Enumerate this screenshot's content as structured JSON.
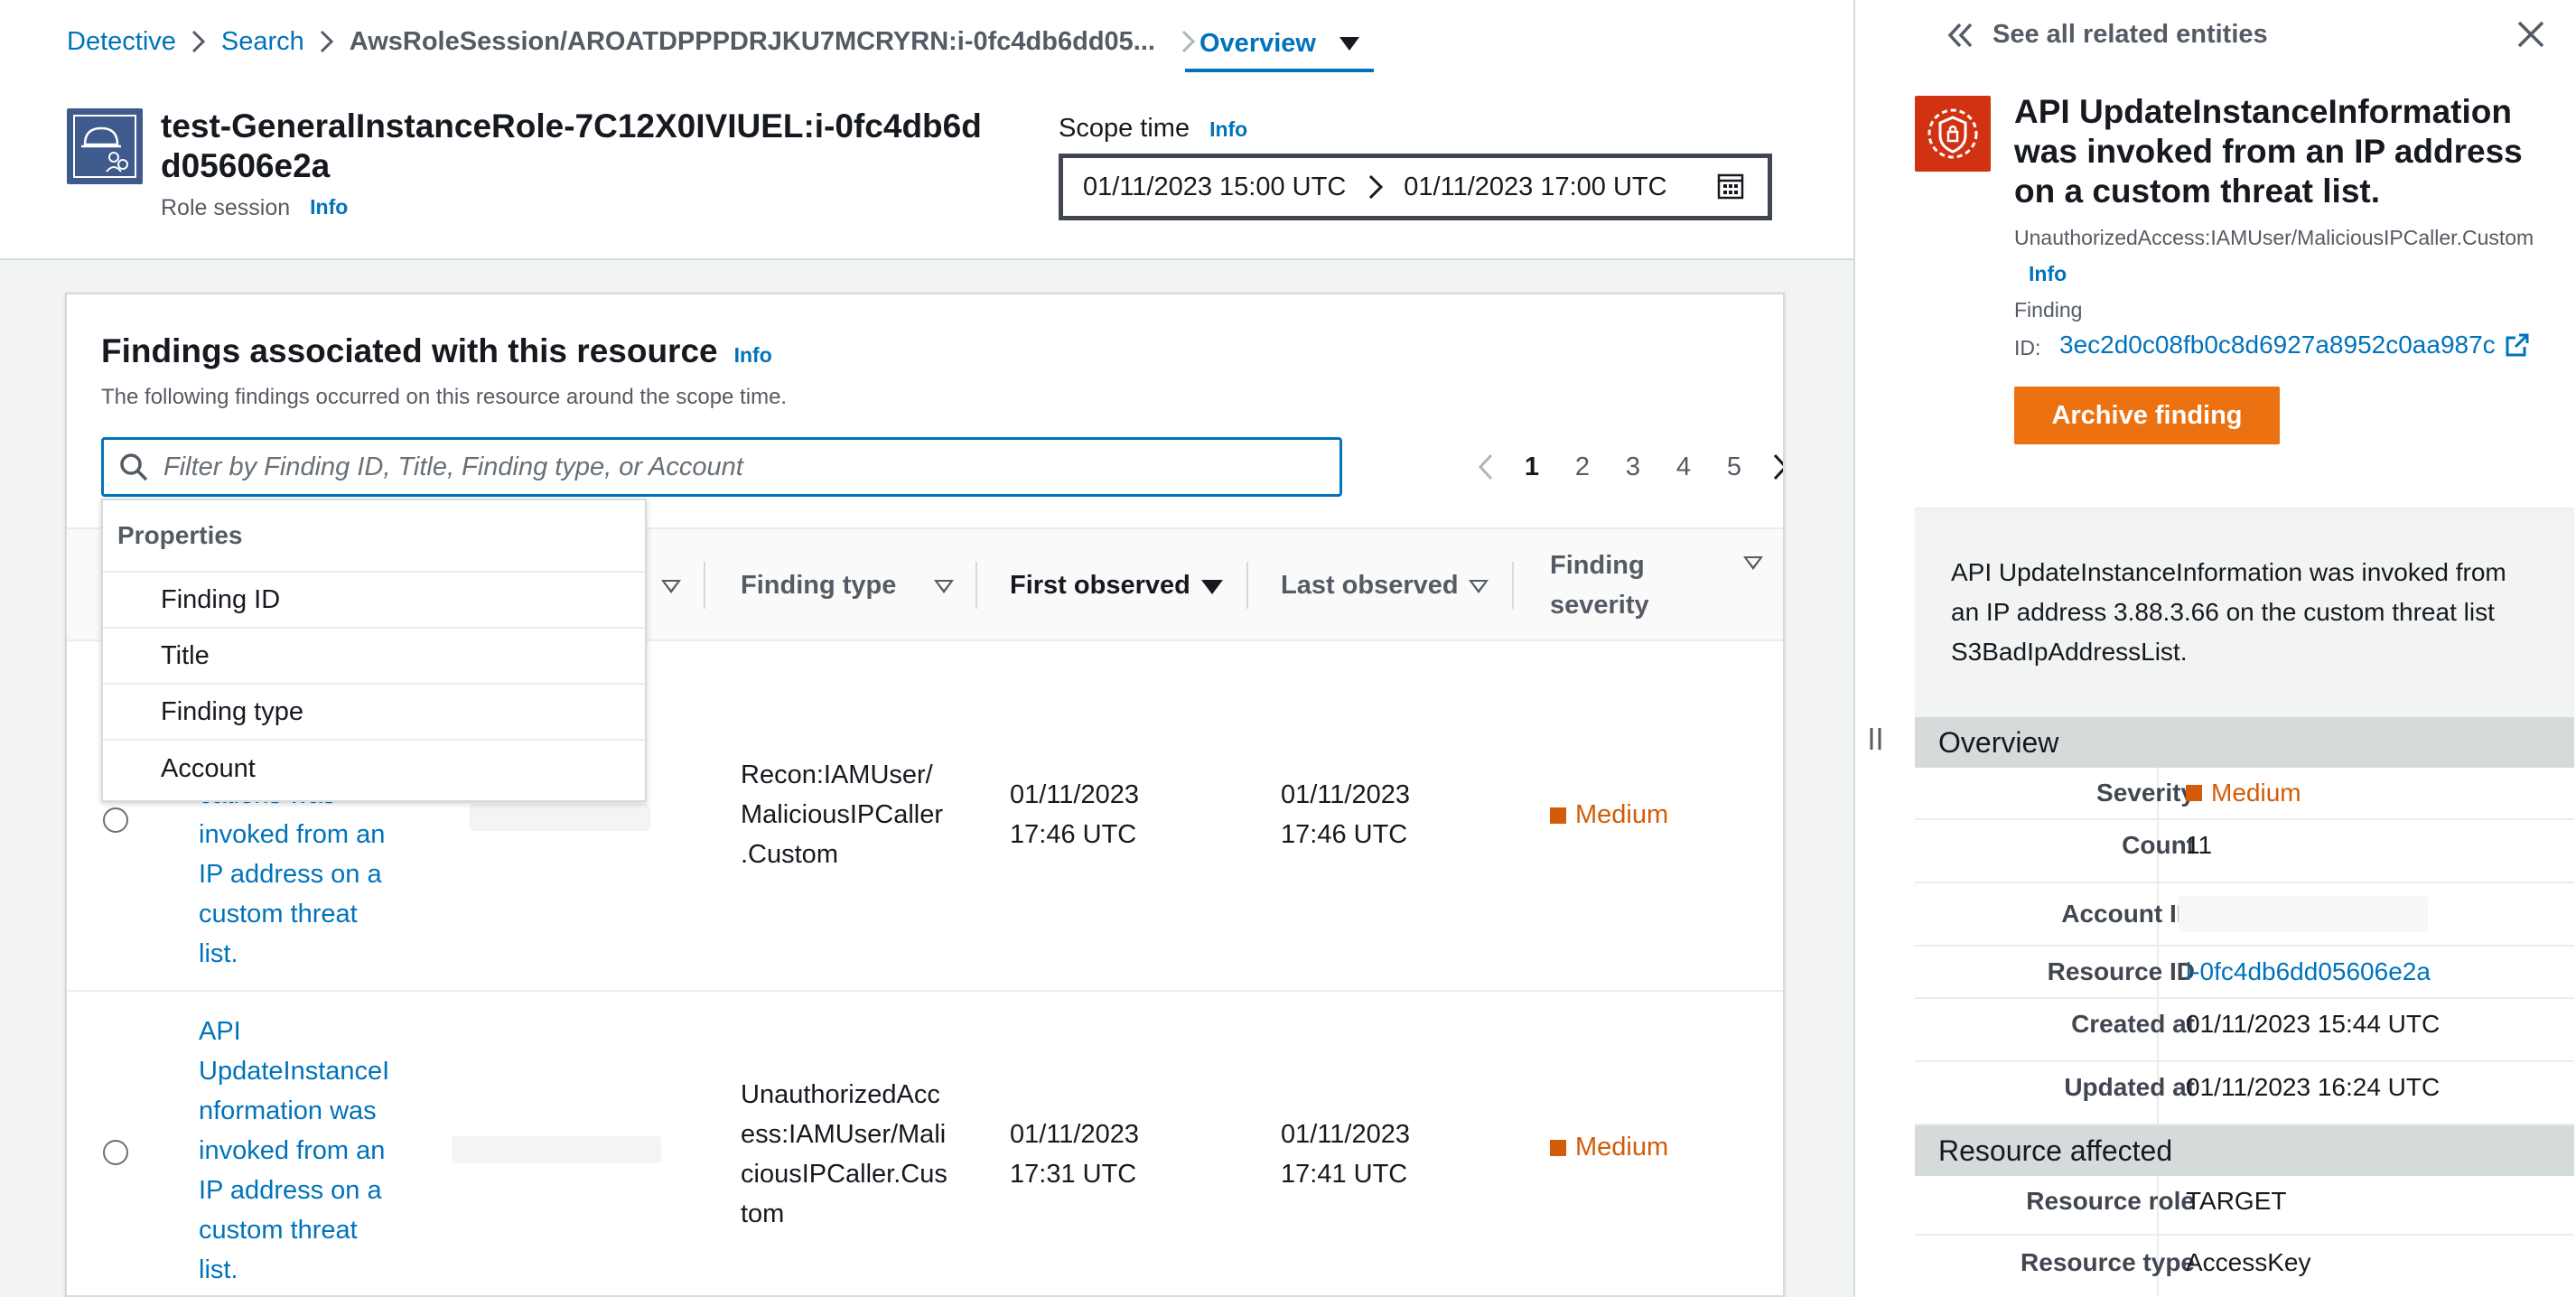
{
  "breadcrumb": {
    "items": [
      "Detective",
      "Search",
      "AwsRoleSession/AROATDPPPDRJKU7MCRYRN:i-0fc4db6dd05..."
    ],
    "current": "Overview"
  },
  "resource": {
    "title": "test-GeneralInstanceRole-7C12X0IVIUEL:i-0fc4db6dd05606e2a",
    "type": "Role session",
    "info": "Info"
  },
  "scope": {
    "label": "Scope time",
    "info": "Info",
    "start": "01/11/2023 15:00 UTC",
    "end": "01/11/2023 17:00 UTC"
  },
  "findings_card": {
    "title": "Findings associated with this resource",
    "info": "Info",
    "description": "The following findings occurred on this resource around the scope time.",
    "filter_placeholder": "Filter by Finding ID, Title, Finding type, or Account",
    "pages": [
      "1",
      "2",
      "3",
      "4",
      "5"
    ],
    "current_page": "1",
    "columns": {
      "finding_type": "Finding type",
      "first_observed": "First observed",
      "last_observed": "Last observed",
      "severity_line1": "Finding",
      "severity_line2": "severity"
    },
    "properties_menu": {
      "header": "Properties",
      "items": [
        "Finding ID",
        "Title",
        "Finding type",
        "Account"
      ]
    },
    "rows": [
      {
        "title_lines": [
          "cations was",
          "invoked from an",
          "IP address on a",
          "custom threat",
          "list."
        ],
        "type_lines": [
          "Recon:IAMUser/",
          "MaliciousIPCaller",
          ".Custom"
        ],
        "first_lines": [
          "01/11/2023",
          "17:46 UTC"
        ],
        "last_lines": [
          "01/11/2023",
          "17:46 UTC"
        ],
        "severity": "Medium"
      },
      {
        "title_lines": [
          "API",
          "UpdateInstanceI",
          "nformation was",
          "invoked from an",
          "IP address on a",
          "custom threat",
          "list."
        ],
        "type_lines": [
          "UnauthorizedAcc",
          "ess:IAMUser/Mali",
          "ciousIPCaller.Cus",
          "tom"
        ],
        "first_lines": [
          "01/11/2023",
          "17:31 UTC"
        ],
        "last_lines": [
          "01/11/2023",
          "17:41 UTC"
        ],
        "severity": "Medium"
      }
    ]
  },
  "panel": {
    "back_label": "See all related entities",
    "finding_title": "API UpdateInstanceInformation was invoked from an IP address on a custom threat list.",
    "finding_type": "UnauthorizedAccess:IAMUser/MaliciousIPCaller.Custom",
    "info": "Info",
    "finding_label": "Finding",
    "id_label": "ID:",
    "finding_id": "3ec2d0c08fb0c8d6927a8952c0aa987c",
    "archive_label": "Archive finding",
    "description": "API UpdateInstanceInformation was invoked from an IP address 3.88.3.66 on the custom threat list S3BadIpAddressList.",
    "overview": {
      "heading": "Overview",
      "severity_label": "Severity",
      "severity": "Medium",
      "count_label": "Count",
      "count": "11",
      "account_label": "Account ID",
      "resource_id_label": "Resource ID",
      "resource_id": "i-0fc4db6dd05606e2a",
      "created_label": "Created at",
      "created": "01/11/2023 15:44 UTC",
      "updated_label": "Updated at",
      "updated": "01/11/2023 16:24 UTC"
    },
    "resource_affected": {
      "heading": "Resource affected",
      "role_label": "Resource role",
      "role": "TARGET",
      "type_label": "Resource type",
      "type": "AccessKey"
    }
  },
  "colors": {
    "link": "#0073bb",
    "medium_severity": "#d45b07",
    "archive_button": "#ec7211",
    "finding_icon": "#d13212",
    "resource_icon": "#3f5a8c"
  },
  "icons": [
    "chevron-right-icon",
    "caret-down-icon",
    "role-session-icon",
    "calendar-icon",
    "search-icon",
    "chevron-left-icon",
    "radio-icon",
    "double-chevron-left-icon",
    "close-icon",
    "threat-shield-icon",
    "external-link-icon",
    "splitter-icon"
  ]
}
